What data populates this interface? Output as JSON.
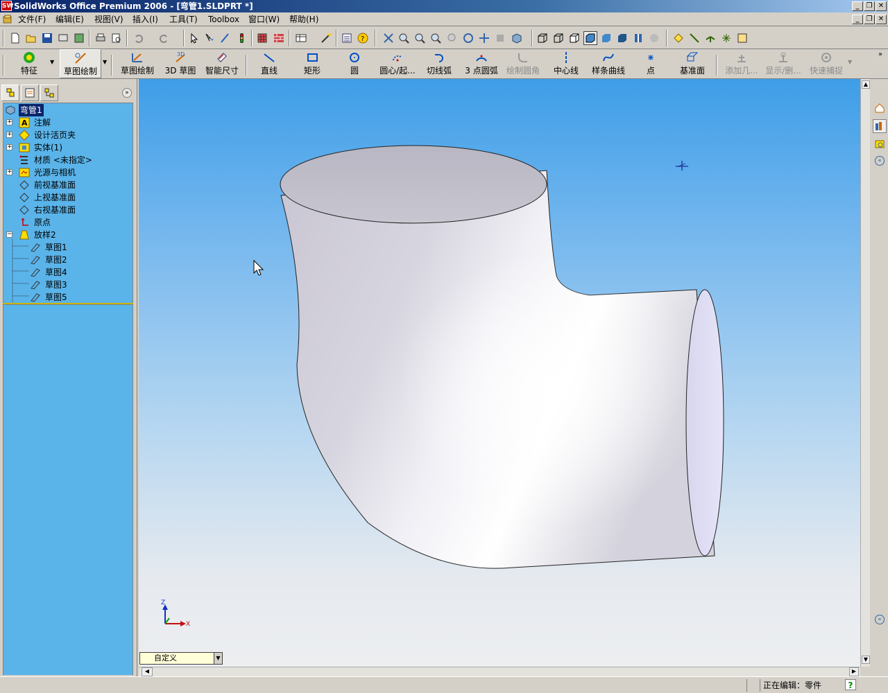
{
  "window": {
    "title": "SolidWorks Office Premium 2006 - [弯管1.SLDPRT *]",
    "app_icon_text": "SW"
  },
  "menu": [
    "文件(F)",
    "编辑(E)",
    "视图(V)",
    "插入(I)",
    "工具(T)",
    "Toolbox",
    "窗口(W)",
    "帮助(H)"
  ],
  "command_manager": {
    "features": "特征",
    "sketch": "草图绘制",
    "items": [
      "草图绘制",
      "3D 草图",
      "智能尺寸",
      "直线",
      "矩形",
      "圆",
      "圆心/起...",
      "切线弧",
      "3 点圆弧",
      "绘制圆角",
      "中心线",
      "样条曲线",
      "点",
      "基准面",
      "添加几...",
      "显示/删...",
      "快速捕捉"
    ],
    "icon_3d_label": "3D"
  },
  "feature_tree": {
    "root": "弯管1",
    "nodes": [
      "注解",
      "设计活页夹",
      "实体(1)",
      "材质 <未指定>",
      "光源与相机",
      "前视基准面",
      "上视基准面",
      "右视基准面",
      "原点",
      "放样2"
    ],
    "children": [
      "草图1",
      "草图2",
      "草图4",
      "草图3",
      "草图5"
    ],
    "annotation_icon_text": "A"
  },
  "viewport": {
    "view_orientation": "自定义",
    "triad": {
      "z": "Z",
      "x": "X"
    }
  },
  "status": {
    "text": "正在编辑：零件",
    "help": "?"
  },
  "colors": {
    "title_start": "#0a246a",
    "title_end": "#a6caf0",
    "tree_bg": "#5ab4ea",
    "viewport_top": "#3e9ee8",
    "viewport_bottom": "#eceef0"
  }
}
